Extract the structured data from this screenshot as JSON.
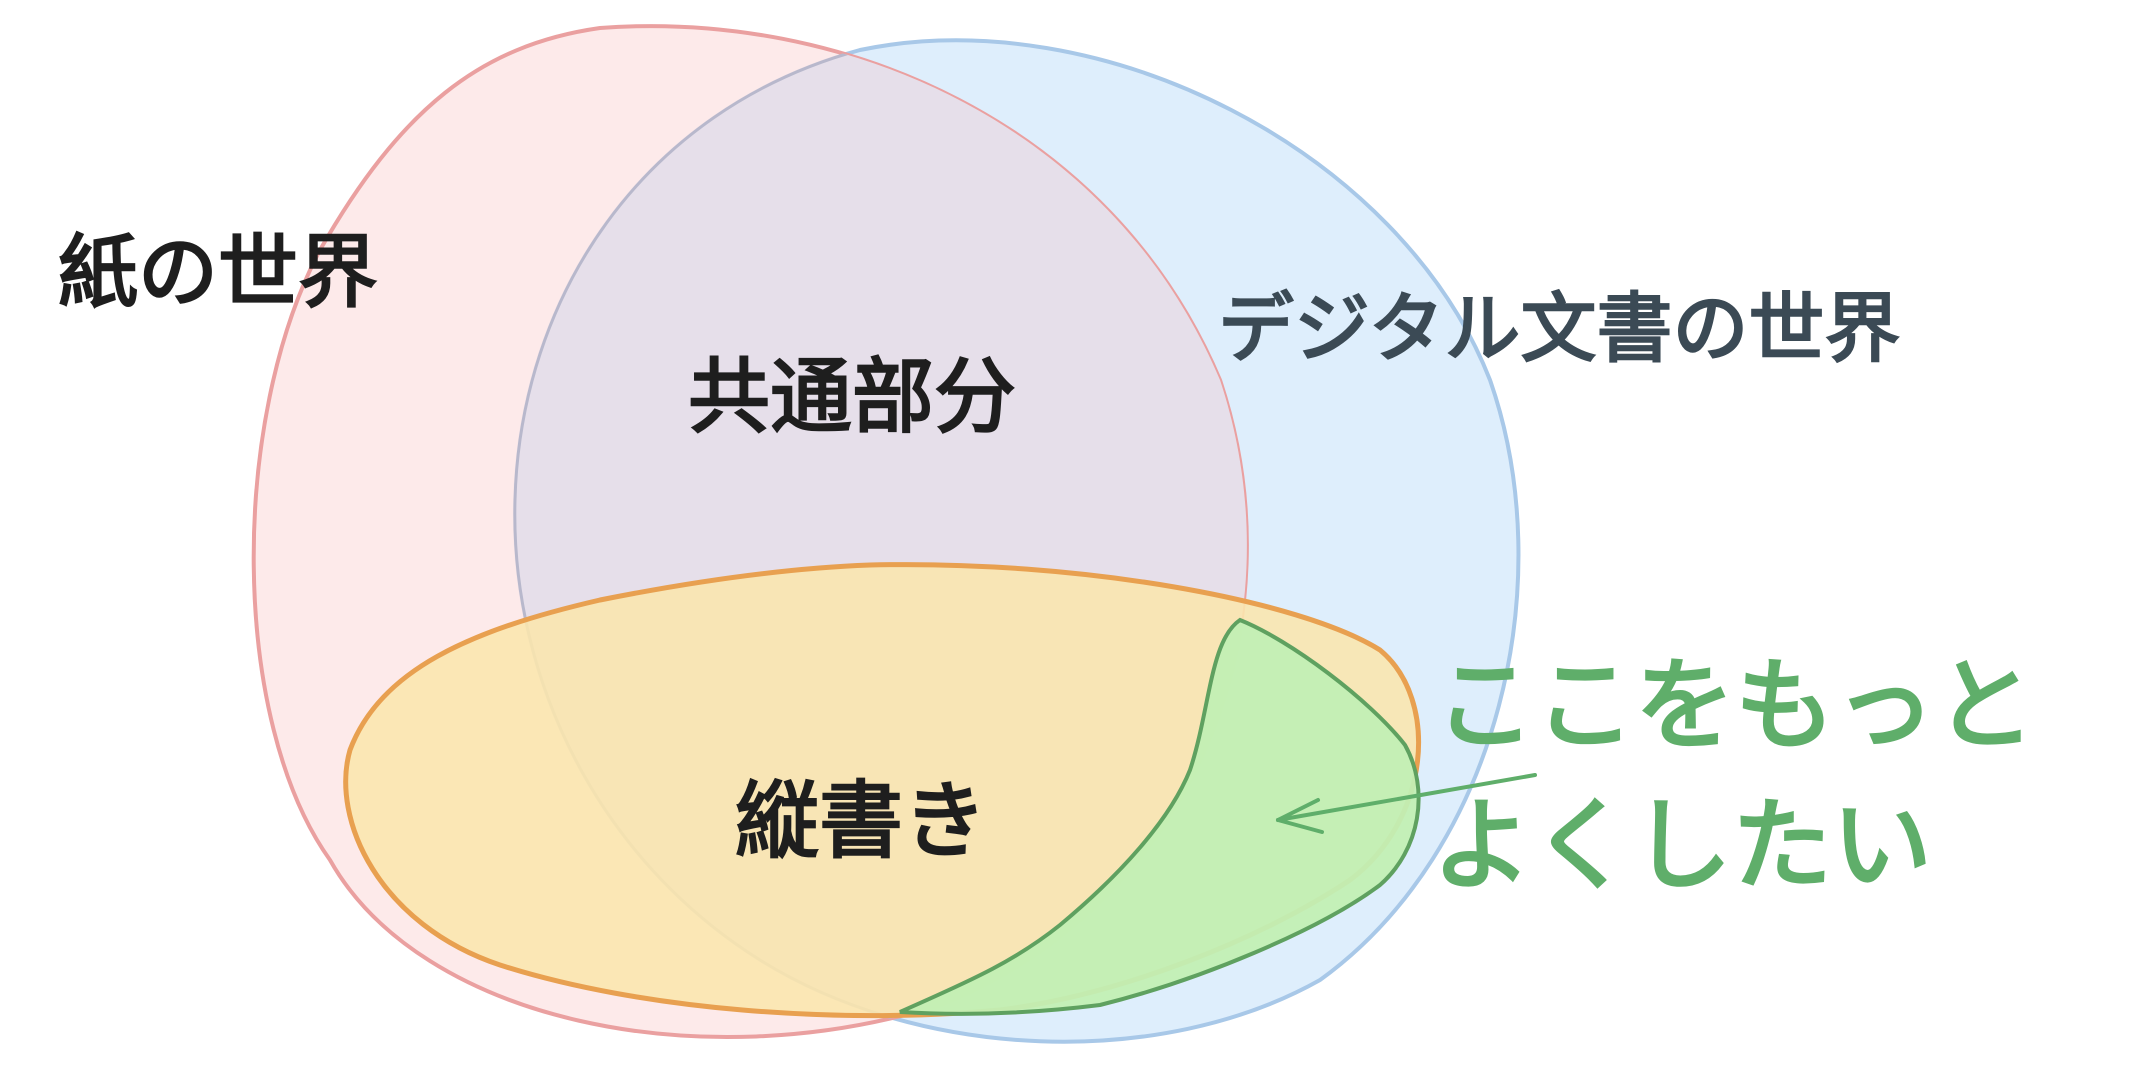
{
  "labels": {
    "paper_world": "紙の世界",
    "digital_world": "デジタル文書の世界",
    "common_part": "共通部分",
    "vertical_writing": "縦書き",
    "note_line1": "ここをもっと",
    "note_line2": "よくしたい"
  },
  "colors": {
    "paper_fill": "#fde8e8",
    "paper_stroke": "#eaa0a0",
    "digital_fill": "#deeefc",
    "digital_stroke": "#a8c8e8",
    "overlap_fill": "#e6dfea",
    "vertical_fill": "#fbe6ad",
    "vertical_stroke": "#e8a050",
    "highlight_fill": "#c2efb4",
    "highlight_stroke": "#5fa160",
    "annotation": "#5fae6a"
  }
}
